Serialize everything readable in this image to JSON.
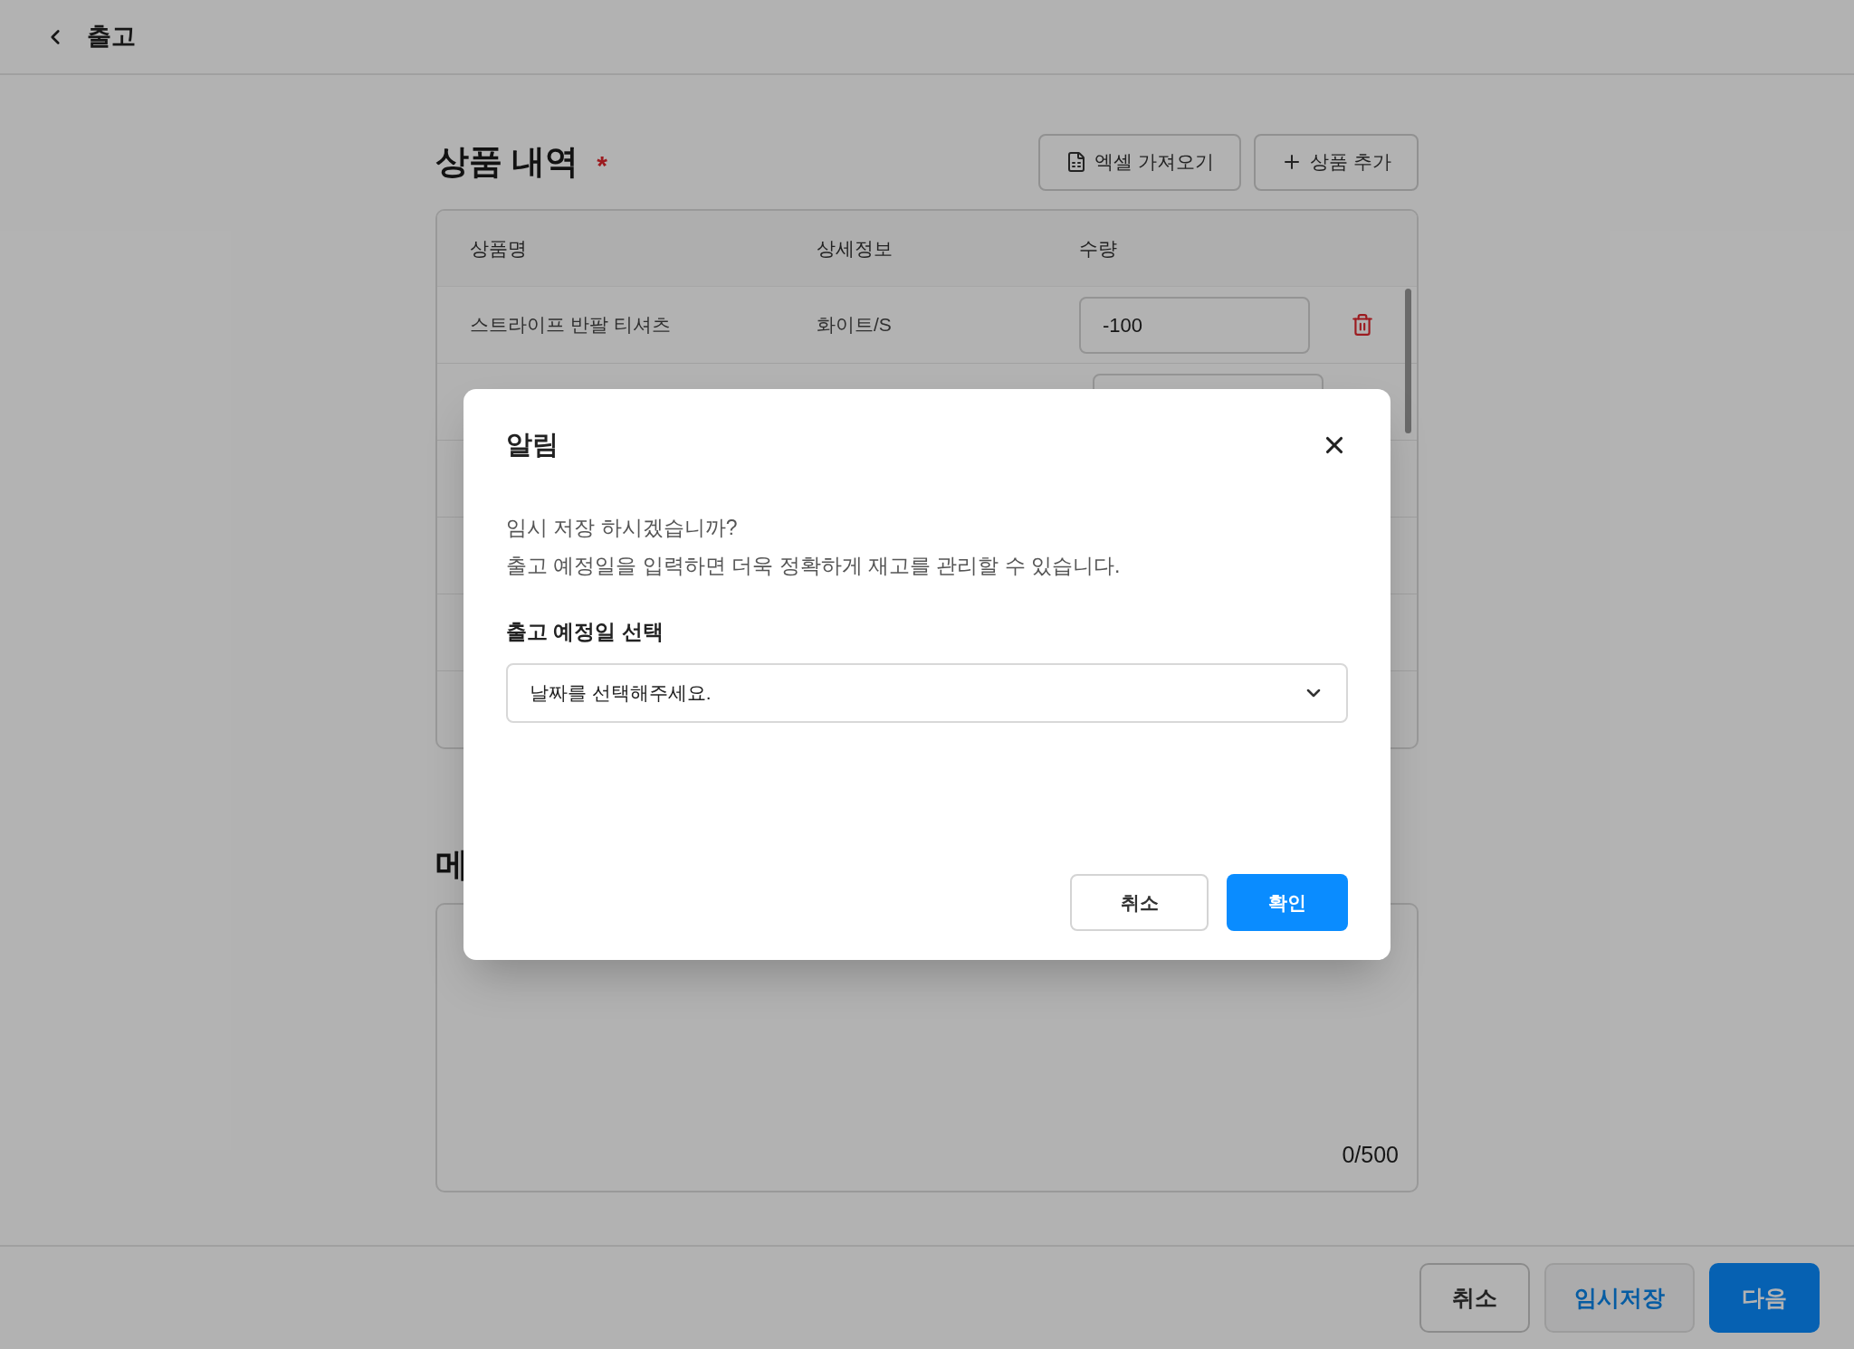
{
  "header": {
    "title": "출고"
  },
  "products": {
    "title": "상품 내역",
    "required_mark": "*",
    "buttons": [
      {
        "kind": "excel",
        "label": "엑셀 가져오기"
      },
      {
        "kind": "add",
        "label": "상품 추가"
      }
    ],
    "columns": [
      "상품명",
      "상세정보",
      "수량"
    ],
    "rows": [
      {
        "name": "스트라이프 반팔 티셔츠",
        "detail": "화이트/S",
        "quantity": "-100"
      }
    ]
  },
  "memo": {
    "title": "메",
    "counter": "0/500"
  },
  "footer": {
    "buttons": [
      {
        "kind": "outline",
        "label": "취소"
      },
      {
        "kind": "secondary",
        "label": "임시저장"
      },
      {
        "kind": "primary",
        "label": "다음"
      }
    ]
  },
  "dialog": {
    "title": "알림",
    "message": [
      "임시 저장 하시겠습니까?",
      "출고 예정일을 입력하면 더욱 정확하게 재고를 관리할 수 있습니다."
    ],
    "field_label": "출고 예정일 선택",
    "select_placeholder": "날짜를 선택해주세요.",
    "buttons": [
      {
        "kind": "outline",
        "label": "취소"
      },
      {
        "kind": "primary",
        "label": "확인"
      }
    ]
  }
}
